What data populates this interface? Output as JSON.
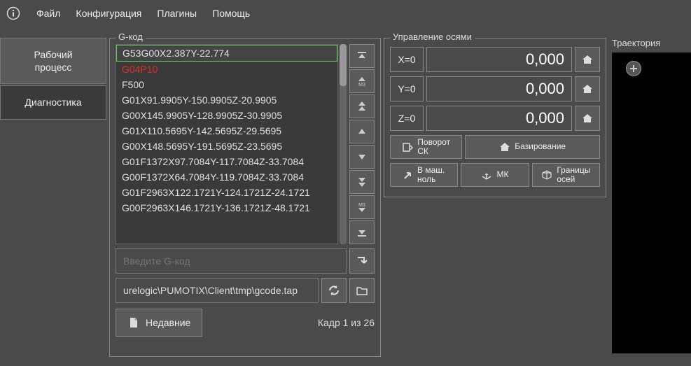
{
  "menu": {
    "file": "Файл",
    "config": "Конфигурация",
    "plugins": "Плагины",
    "help": "Помощь"
  },
  "sidebar": {
    "workflow": "Рабочий\nпроцесс",
    "diag": "Диагностика"
  },
  "gcode": {
    "title": "G-код",
    "lines": [
      "G53G00X2.387Y-22.774",
      "G04P10",
      "F500",
      "G01X91.9905Y-150.9905Z-20.9905",
      "G00X145.9905Y-128.9905Z-30.9905",
      "G01X110.5695Y-142.5695Z-29.5695",
      "G00X148.5695Y-191.5695Z-23.5695",
      "G01F1372X97.7084Y-117.7084Z-33.7084",
      "G00F1372X64.7084Y-119.7084Z-33.7084",
      "G01F2963X122.1721Y-124.1721Z-24.1721",
      "G00F2963X146.1721Y-136.1721Z-48.1721"
    ],
    "input_placeholder": "Введите G-код",
    "path": "urelogic\\PUMOTIX\\Client\\tmp\\gcode.tap",
    "recent": "Недавние",
    "frame_text": "Кадр 1 из 26"
  },
  "axes": {
    "title": "Управление осями",
    "items": [
      {
        "label": "X=0",
        "value": "0,000"
      },
      {
        "label": "Y=0",
        "value": "0,000"
      },
      {
        "label": "Z=0",
        "value": "0,000"
      }
    ],
    "rotate_cs": "Поворот\nСК",
    "homing": "Базирование",
    "to_mach_zero": "В маш.\nноль",
    "mk": "МК",
    "axis_limits": "Границы\nосей"
  },
  "traj": {
    "title": "Траектория"
  }
}
